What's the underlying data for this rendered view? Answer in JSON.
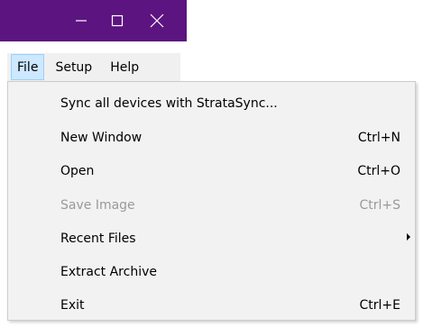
{
  "window_controls": {
    "minimize_icon": "minimize-icon",
    "maximize_icon": "maximize-icon",
    "close_icon": "close-icon",
    "titlebar_color": "#5c1480"
  },
  "menubar": {
    "items": [
      {
        "label": "File",
        "active": true
      },
      {
        "label": "Setup",
        "active": false
      },
      {
        "label": "Help",
        "active": false
      }
    ]
  },
  "file_menu": {
    "items": [
      {
        "label": "Sync all devices with StrataSync...",
        "shortcut": "",
        "enabled": true,
        "submenu": false
      },
      {
        "label": "New Window",
        "shortcut": "Ctrl+N",
        "enabled": true,
        "submenu": false
      },
      {
        "label": "Open",
        "shortcut": "Ctrl+O",
        "enabled": true,
        "submenu": false
      },
      {
        "label": "Save Image",
        "shortcut": "Ctrl+S",
        "enabled": false,
        "submenu": false
      },
      {
        "label": "Recent Files",
        "shortcut": "",
        "enabled": true,
        "submenu": true
      },
      {
        "label": "Extract Archive",
        "shortcut": "",
        "enabled": true,
        "submenu": false
      },
      {
        "label": "Exit",
        "shortcut": "Ctrl+E",
        "enabled": true,
        "submenu": false
      }
    ]
  }
}
